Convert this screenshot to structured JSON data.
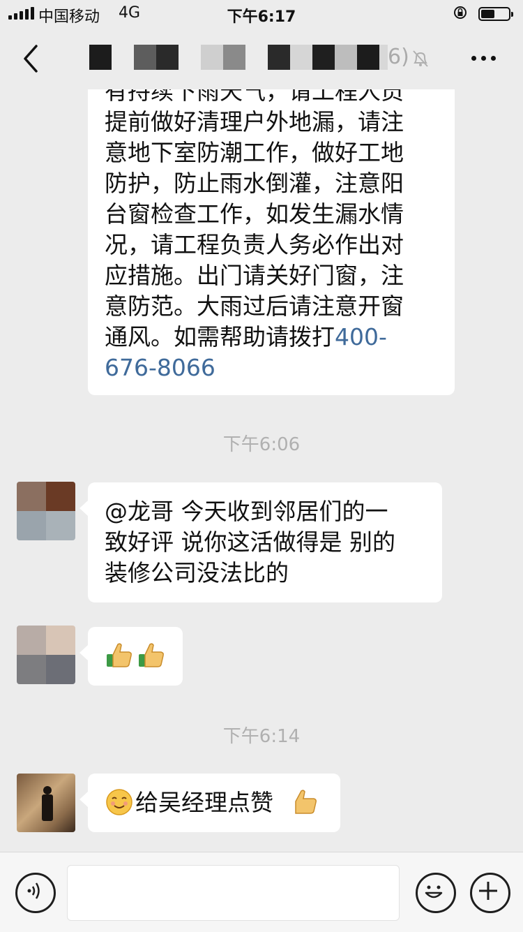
{
  "status_bar": {
    "carrier": "中国移动",
    "network": "4G",
    "time": "下午6:17"
  },
  "nav": {
    "title_suffix": "6)"
  },
  "messages": {
    "first": {
      "lines": [
        "有持续下雨天气，请工程人员",
        "提前做好清理户外地漏，请注",
        "意地下室防潮工作，做好工地",
        "防护，防止雨水倒灌，注意阳",
        "台窗检查工作，如发生漏水情",
        "况，请工程负责人务必作出对",
        "应措施。出门请关好门窗，注",
        "意防范。大雨过后请注意开窗",
        "通风。如需帮助请拨打"
      ],
      "phone_part1": "400-",
      "phone_part2": "676-8066"
    },
    "timestamp_1": "下午6:06",
    "second": {
      "lines": [
        "@龙哥 今天收到邻居们的一",
        "致好评 说你这活做得是 别的",
        "装修公司没法比的"
      ]
    },
    "third": {
      "icons": [
        "thumbs-up-icon",
        "thumbs-up-icon"
      ]
    },
    "timestamp_2": "下午6:14",
    "fourth": {
      "text": "给吴经理点赞",
      "icons": [
        "blushing-smile-icon",
        "thumbs-up-icon"
      ]
    }
  },
  "colors": {
    "background": "#ececec",
    "bubble": "#ffffff",
    "link": "#3f6a9a",
    "timestamp": "#b0b0b0"
  },
  "input_bar": {
    "icons": [
      "voice-icon",
      "emoji-icon",
      "add-icon"
    ]
  }
}
